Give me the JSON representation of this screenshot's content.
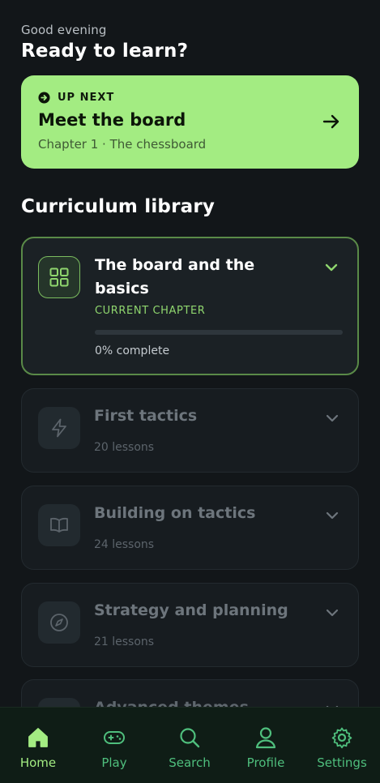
{
  "header": {
    "greeting": "Good evening",
    "headline": "Ready to learn?"
  },
  "up_next": {
    "tag": "UP NEXT",
    "title": "Meet the board",
    "subtitle": "Chapter 1 · The chessboard",
    "icon": "arrow-right-icon",
    "tag_icon": "arrow-circle-icon",
    "background": "#a3ec82"
  },
  "library": {
    "title": "Curriculum library",
    "current": {
      "title": "The board and the basics",
      "status": "CURRENT CHAPTER",
      "progress": 0,
      "progress_label": "0% complete",
      "icon": "grid-icon",
      "accent": "#8fd66e"
    },
    "chapters": [
      {
        "title": "First tactics",
        "lessons": "20 lessons",
        "icon": "lightning-icon"
      },
      {
        "title": "Building on tactics",
        "lessons": "24 lessons",
        "icon": "book-icon"
      },
      {
        "title": "Strategy and planning",
        "lessons": "21 lessons",
        "icon": "compass-icon"
      },
      {
        "title": "Advanced themes",
        "icon": "target-icon"
      }
    ]
  },
  "nav": {
    "items": [
      {
        "label": "Home",
        "icon": "home-icon",
        "active": true
      },
      {
        "label": "Play",
        "icon": "gamepad-icon"
      },
      {
        "label": "Search",
        "icon": "search-icon"
      },
      {
        "label": "Profile",
        "icon": "profile-icon"
      },
      {
        "label": "Settings",
        "icon": "gear-icon"
      }
    ],
    "active_color": "#a3ec82",
    "inactive_color": "#4fbf7d"
  }
}
